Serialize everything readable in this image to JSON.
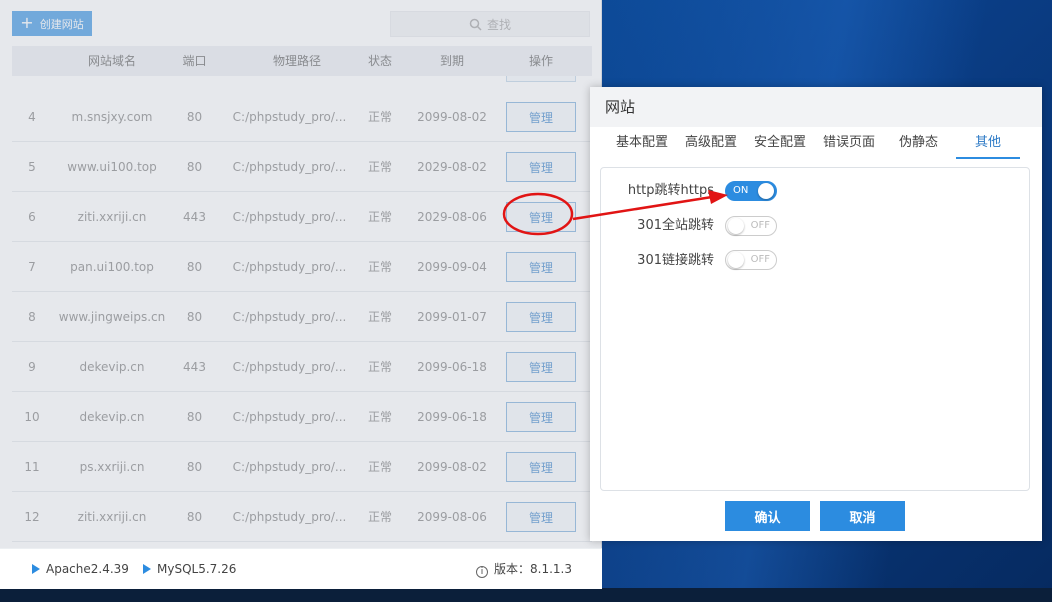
{
  "toolbar": {
    "create_label": "创建网站",
    "search_label": "查找"
  },
  "table": {
    "headers": [
      "网站域名",
      "端口",
      "物理路径",
      "状态",
      "到期",
      "操作"
    ],
    "rows": [
      {
        "id": "4",
        "domain": "m.snsjxy.com",
        "port": "80",
        "path": "C:/phpstudy_pro/...",
        "status": "正常",
        "expire": "2099-08-02",
        "action": "管理"
      },
      {
        "id": "5",
        "domain": "www.ui100.top",
        "port": "80",
        "path": "C:/phpstudy_pro/...",
        "status": "正常",
        "expire": "2029-08-02",
        "action": "管理"
      },
      {
        "id": "6",
        "domain": "ziti.xxriji.cn",
        "port": "443",
        "path": "C:/phpstudy_pro/...",
        "status": "正常",
        "expire": "2029-08-06",
        "action": "管理"
      },
      {
        "id": "7",
        "domain": "pan.ui100.top",
        "port": "80",
        "path": "C:/phpstudy_pro/...",
        "status": "正常",
        "expire": "2099-09-04",
        "action": "管理"
      },
      {
        "id": "8",
        "domain": "www.jingweips.cn",
        "port": "80",
        "path": "C:/phpstudy_pro/...",
        "status": "正常",
        "expire": "2099-01-07",
        "action": "管理"
      },
      {
        "id": "9",
        "domain": "dekevip.cn",
        "port": "443",
        "path": "C:/phpstudy_pro/...",
        "status": "正常",
        "expire": "2099-06-18",
        "action": "管理"
      },
      {
        "id": "10",
        "domain": "dekevip.cn",
        "port": "80",
        "path": "C:/phpstudy_pro/...",
        "status": "正常",
        "expire": "2099-06-18",
        "action": "管理"
      },
      {
        "id": "11",
        "domain": "ps.xxriji.cn",
        "port": "80",
        "path": "C:/phpstudy_pro/...",
        "status": "正常",
        "expire": "2099-08-02",
        "action": "管理"
      },
      {
        "id": "12",
        "domain": "ziti.xxriji.cn",
        "port": "80",
        "path": "C:/phpstudy_pro/...",
        "status": "正常",
        "expire": "2099-08-06",
        "action": "管理"
      }
    ]
  },
  "statusbar": {
    "apache": "Apache2.4.39",
    "mysql": "MySQL5.7.26",
    "version": "版本：8.1.1.3"
  },
  "dialog": {
    "title": "网站",
    "tabs": [
      "基本配置",
      "高级配置",
      "安全配置",
      "错误页面",
      "伪静态",
      "其他"
    ],
    "active_tab": "其他",
    "options": [
      {
        "label": "http跳转https",
        "state": "ON"
      },
      {
        "label": "301全站跳转",
        "state": "OFF"
      },
      {
        "label": "301链接跳转",
        "state": "OFF"
      }
    ],
    "confirm_label": "确认",
    "cancel_label": "取消"
  },
  "colors": {
    "accent": "#2c8ce0",
    "annotation": "#e11414"
  }
}
